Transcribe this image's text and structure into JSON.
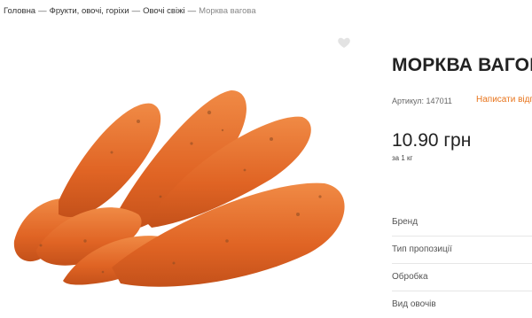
{
  "breadcrumb": {
    "items": [
      "Головна",
      "Фрукти, овочі, горіхи",
      "Овочі свіжі"
    ],
    "separator": "—",
    "current": "Морква вагова"
  },
  "product": {
    "title": "МОРКВА ВАГОВА",
    "sku": "Артикул: 147011",
    "review_link": "Написати відгук",
    "price": "10.90 грн",
    "unit": "за 1 кг",
    "favorite_icon": "heart-icon"
  },
  "attributes": [
    "Бренд",
    "Тип пропозиції",
    "Обробка",
    "Вид овочів"
  ],
  "colors": {
    "accent": "#e8741b",
    "carrot": "#e5692a"
  }
}
